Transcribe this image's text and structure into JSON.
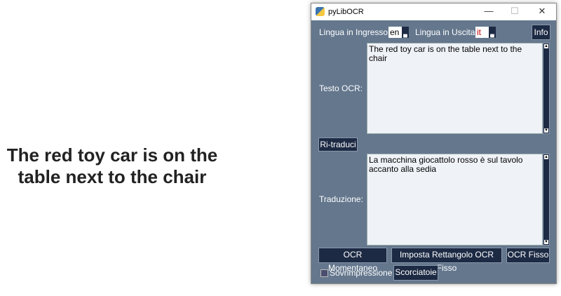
{
  "image_text": {
    "line1": "The red toy car is on the",
    "line2": "table next to the chair"
  },
  "window": {
    "title": "pyLibOCR",
    "minimize": "—",
    "maximize": "☐",
    "close": "✕"
  },
  "toolbar": {
    "input_label": "Lingua in Ingresso",
    "input_lang": "en",
    "output_label": "Lingua in Uscita",
    "output_lang": "it",
    "info": "Info"
  },
  "ocr": {
    "label": "Testo OCR:",
    "text": "The red toy car is on the table next to the chair"
  },
  "retranslate": "Ri-traduci",
  "translation": {
    "label": "Traduzione:",
    "text": "La macchina giocattolo rosso è sul tavolo accanto alla sedia"
  },
  "buttons": {
    "momentary": "OCR Momentaneo",
    "set_rect": "Imposta Rettangolo OCR Fisso",
    "fixed": "OCR Fisso",
    "shortcuts": "Scorciatoie"
  },
  "overlay": {
    "label": "Sovrimpressione",
    "checked": false
  }
}
